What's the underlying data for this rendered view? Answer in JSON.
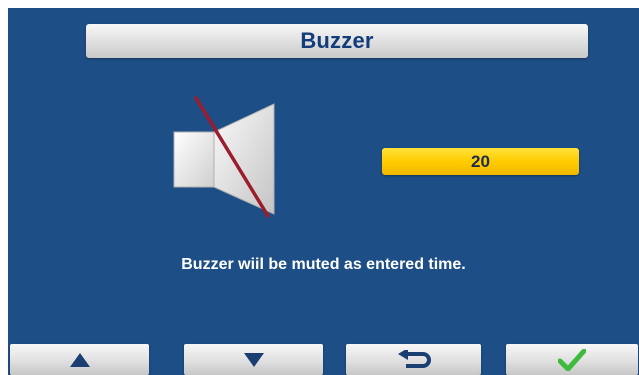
{
  "header": {
    "title": "Buzzer"
  },
  "main": {
    "icon": "speaker-muted-icon",
    "mute_time": {
      "value": "20"
    },
    "message": "Buzzer wiil be muted as entered time."
  },
  "footer": {
    "buttons": [
      {
        "icon": "arrow-up-icon"
      },
      {
        "icon": "arrow-down-icon"
      },
      {
        "icon": "return-icon"
      },
      {
        "icon": "checkmark-icon"
      }
    ]
  },
  "colors": {
    "background": "#1d4f86",
    "title_text": "#123c7a",
    "value_field": "#ffcc00",
    "icon_dark": "#1b3f73",
    "check_green": "#3dbb3d",
    "mute_slash": "#9b1c2c"
  }
}
